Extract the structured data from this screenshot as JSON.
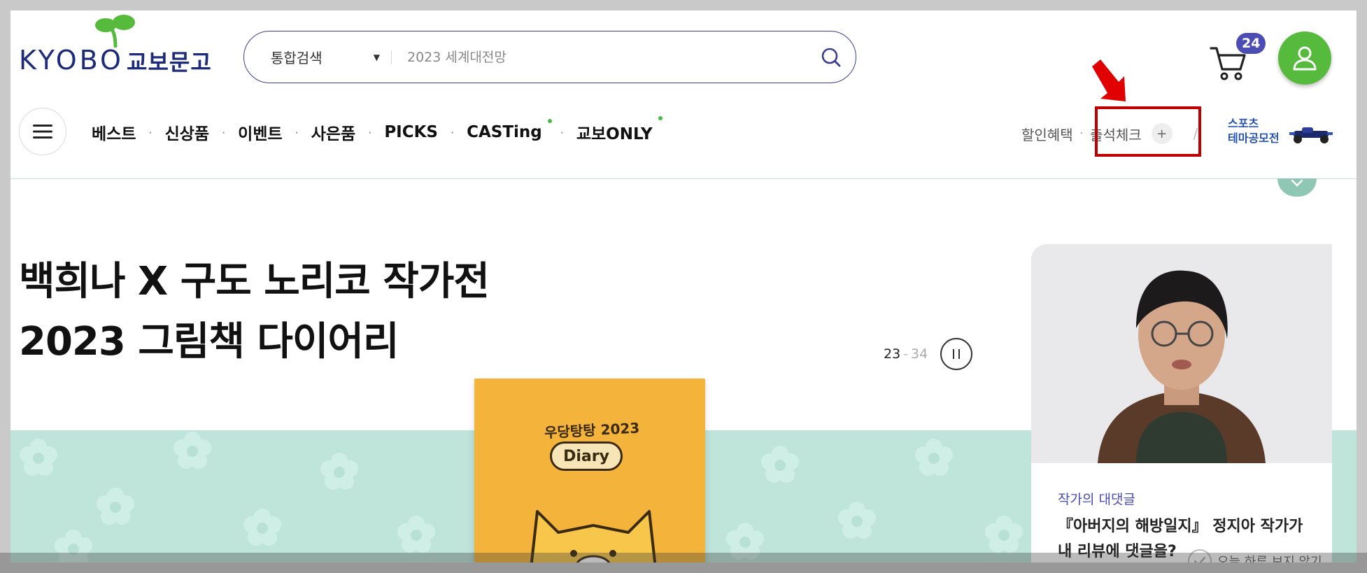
{
  "header": {
    "logo_text": "KYOBO",
    "logo_korean": "교보문고",
    "search": {
      "type_label": "통합검색",
      "placeholder": "2023 세계대전망"
    },
    "cart_count": "24"
  },
  "nav": {
    "items": [
      {
        "label": "베스트",
        "dot": false
      },
      {
        "label": "신상품",
        "dot": false
      },
      {
        "label": "이벤트",
        "dot": false
      },
      {
        "label": "사은품",
        "dot": false
      },
      {
        "label": "PICKS",
        "dot": false
      },
      {
        "label": "CASTing",
        "dot": true
      },
      {
        "label": "교보ONLY",
        "dot": true
      }
    ],
    "util": {
      "discount": "할인혜택",
      "attendance": "출석체크"
    },
    "theme_banner": {
      "line1": "스포츠",
      "line2": "테마공모전"
    }
  },
  "banner": {
    "headline_line1": "백희나 X 구도 노리코 작가전",
    "headline_line2": "2023 그림책 다이어리",
    "pager_current": "23",
    "pager_sep": "-",
    "pager_total": "34",
    "diary_title": "우당탕탕 2023",
    "diary_badge": "Diary"
  },
  "side_card": {
    "label": "작가의 대댓글",
    "title": "『아버지의 해방일지』 정지아 작가가 내 리뷰에 댓글을?"
  },
  "popup": {
    "no_show_today": "오늘 하루 보지 않기"
  },
  "colors": {
    "brand_navy": "#1d2b7a",
    "brand_green": "#56bb3d",
    "badge_purple": "#4b4db4",
    "highlight_red": "#c00000",
    "banner_mint": "#bfe5db",
    "diary_orange": "#f4b33a"
  }
}
